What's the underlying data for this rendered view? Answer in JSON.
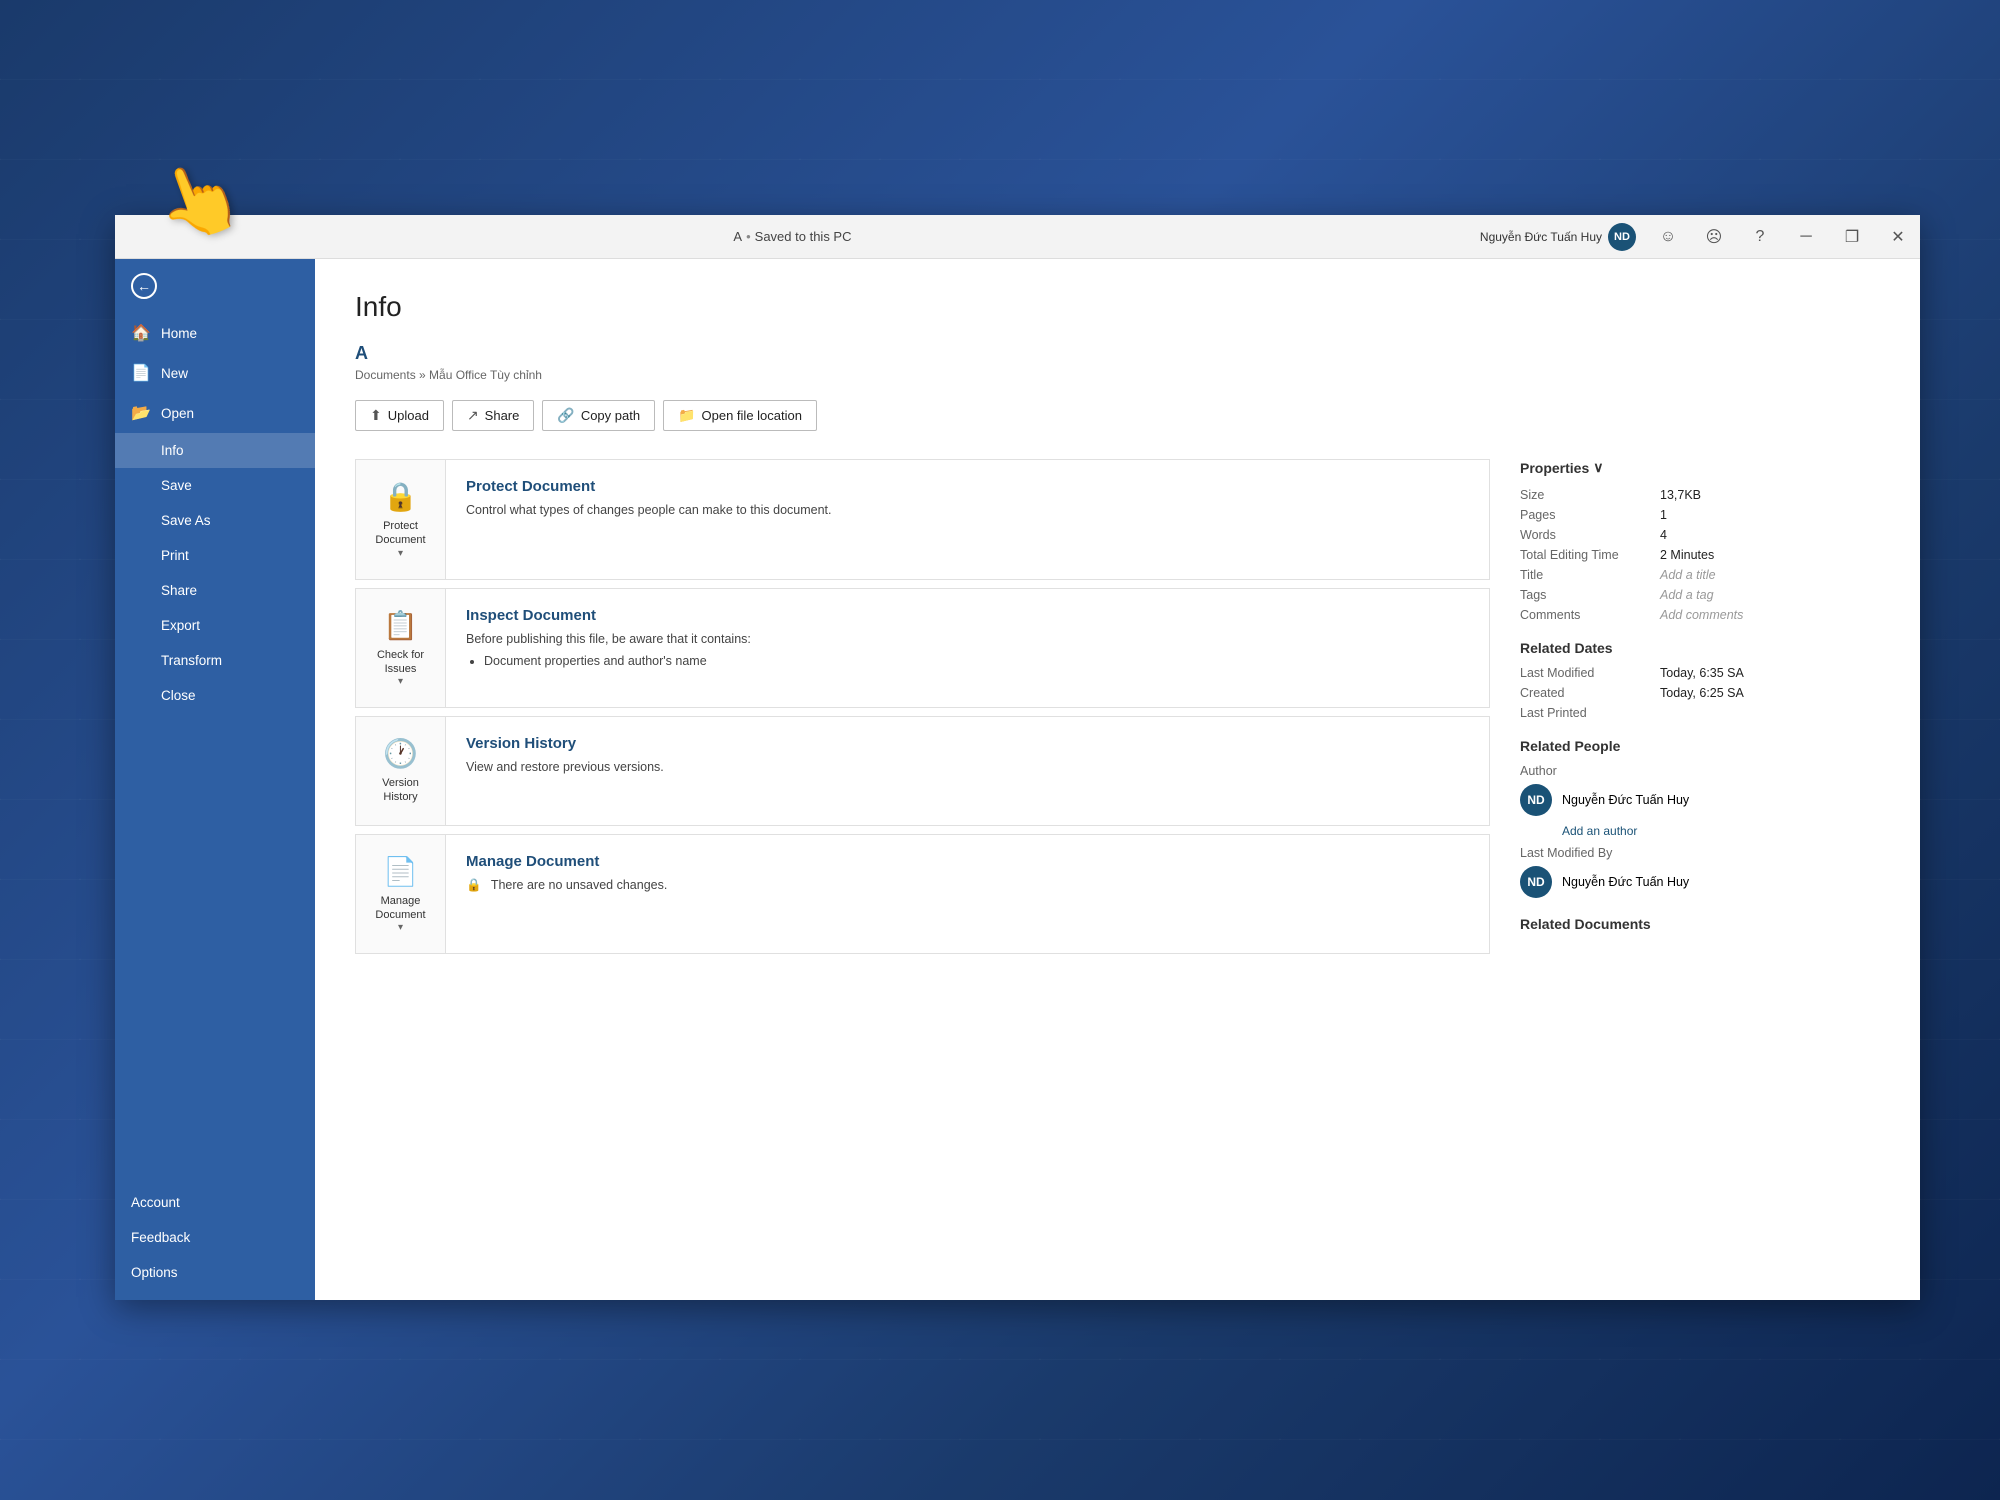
{
  "background": {
    "color": "#1a3a6b"
  },
  "titlebar": {
    "doc_title": "A",
    "saved_status": "Saved to this PC",
    "separator": "•",
    "user_name": "Nguyễn Đức Tuấn Huy",
    "user_initials": "ND",
    "buttons": {
      "minimize": "—",
      "maximize": "❐",
      "close": "✕",
      "emoji1": "☺",
      "emoji2": "☹",
      "help": "?"
    }
  },
  "sidebar": {
    "back_label": "",
    "items": [
      {
        "id": "home",
        "label": "Home",
        "icon": "🏠"
      },
      {
        "id": "new",
        "label": "New",
        "icon": "📄"
      },
      {
        "id": "open",
        "label": "Open",
        "icon": "📂"
      },
      {
        "id": "info",
        "label": "Info",
        "icon": "",
        "active": true
      },
      {
        "id": "save",
        "label": "Save",
        "icon": ""
      },
      {
        "id": "save-as",
        "label": "Save As",
        "icon": ""
      },
      {
        "id": "print",
        "label": "Print",
        "icon": ""
      },
      {
        "id": "share",
        "label": "Share",
        "icon": ""
      },
      {
        "id": "export",
        "label": "Export",
        "icon": ""
      },
      {
        "id": "transform",
        "label": "Transform",
        "icon": ""
      },
      {
        "id": "close",
        "label": "Close",
        "icon": ""
      }
    ],
    "bottom_items": [
      {
        "id": "account",
        "label": "Account"
      },
      {
        "id": "feedback",
        "label": "Feedback"
      },
      {
        "id": "options",
        "label": "Options"
      }
    ]
  },
  "info_page": {
    "title": "Info",
    "doc_name": "A",
    "doc_path": "Documents » Mẫu Office Tùy chỉnh",
    "action_buttons": [
      {
        "id": "upload",
        "label": "Upload",
        "icon": "⬆"
      },
      {
        "id": "share",
        "label": "Share",
        "icon": "↗"
      },
      {
        "id": "copy-path",
        "label": "Copy path",
        "icon": "🔗"
      },
      {
        "id": "open-location",
        "label": "Open file location",
        "icon": "📁"
      }
    ],
    "sections": [
      {
        "id": "protect-document",
        "icon": "🔒",
        "icon_label": "Protect\nDocument",
        "has_chevron": true,
        "title": "Protect Document",
        "description": "Control what types of changes people can make to this document."
      },
      {
        "id": "inspect-document",
        "icon": "📋",
        "icon_label": "Check for\nIssues",
        "has_chevron": true,
        "title": "Inspect Document",
        "description": "Before publishing this file, be aware that it contains:",
        "list_items": [
          "Document properties and author's name"
        ]
      },
      {
        "id": "version-history",
        "icon": "🕐",
        "icon_label": "Version\nHistory",
        "has_chevron": false,
        "title": "Version History",
        "description": "View and restore previous versions."
      },
      {
        "id": "manage-document",
        "icon": "📄",
        "icon_label": "Manage\nDocument",
        "has_chevron": true,
        "title": "Manage Document",
        "description": "There are no unsaved changes.",
        "has_lock_icon": true
      }
    ],
    "properties": {
      "header": "Properties",
      "chevron": "∨",
      "items": [
        {
          "label": "Size",
          "value": "13,7KB"
        },
        {
          "label": "Pages",
          "value": "1"
        },
        {
          "label": "Words",
          "value": "4"
        },
        {
          "label": "Total Editing Time",
          "value": "2 Minutes"
        },
        {
          "label": "Title",
          "value": "Add a title",
          "muted": true
        },
        {
          "label": "Tags",
          "value": "Add a tag",
          "muted": true
        },
        {
          "label": "Comments",
          "value": "Add comments",
          "muted": true
        }
      ]
    },
    "related_dates": {
      "header": "Related Dates",
      "items": [
        {
          "label": "Last Modified",
          "value": "Today, 6:35 SA"
        },
        {
          "label": "Created",
          "value": "Today, 6:25 SA"
        },
        {
          "label": "Last Printed",
          "value": ""
        }
      ]
    },
    "related_people": {
      "header": "Related People",
      "author_label": "Author",
      "author_name": "Nguyễn Đức Tuấn Huy",
      "author_initials": "ND",
      "add_author": "Add an author",
      "last_modified_label": "Last Modified By",
      "last_modified_name": "Nguyễn Đức Tuấn Huy",
      "last_modified_initials": "ND"
    },
    "related_documents": {
      "header": "Related Documents"
    }
  },
  "hand_cursor": "👆"
}
